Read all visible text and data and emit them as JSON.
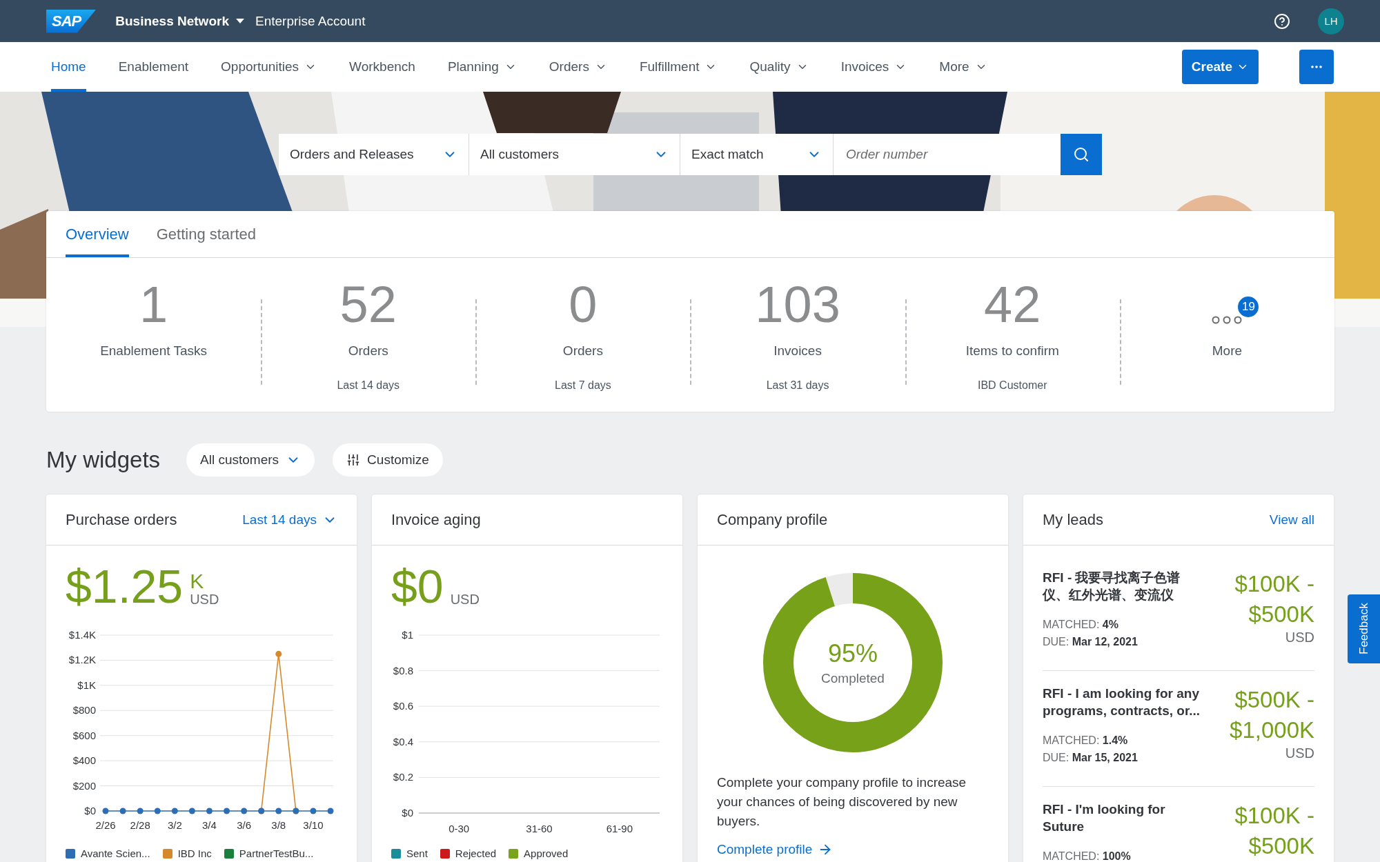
{
  "topbar": {
    "logo": "SAP",
    "product": "Business Network",
    "account": "Enterprise Account",
    "avatar": "LH"
  },
  "nav": {
    "items": [
      {
        "label": "Home",
        "selected": true,
        "has_menu": false
      },
      {
        "label": "Enablement",
        "selected": false,
        "has_menu": false
      },
      {
        "label": "Opportunities",
        "selected": false,
        "has_menu": true
      },
      {
        "label": "Workbench",
        "selected": false,
        "has_menu": false
      },
      {
        "label": "Planning",
        "selected": false,
        "has_menu": true
      },
      {
        "label": "Orders",
        "selected": false,
        "has_menu": true
      },
      {
        "label": "Fulfillment",
        "selected": false,
        "has_menu": true
      },
      {
        "label": "Quality",
        "selected": false,
        "has_menu": true
      },
      {
        "label": "Invoices",
        "selected": false,
        "has_menu": true
      },
      {
        "label": "More",
        "selected": false,
        "has_menu": true
      }
    ],
    "create_button": "Create"
  },
  "search": {
    "scope": "Orders and Releases",
    "customer": "All customers",
    "match": "Exact match",
    "placeholder": "Order number"
  },
  "overview": {
    "tabs": [
      {
        "label": "Overview",
        "selected": true
      },
      {
        "label": "Getting started",
        "selected": false
      }
    ],
    "tiles": [
      {
        "kind": "count",
        "value": "1",
        "label": "Enablement Tasks"
      },
      {
        "kind": "count",
        "value": "52",
        "label": "Orders",
        "period": "Last 14 days"
      },
      {
        "kind": "count",
        "value": "0",
        "label": "Orders",
        "period": "Last 7 days"
      },
      {
        "kind": "count",
        "value": "103",
        "label": "Invoices",
        "period": "Last 31 days"
      },
      {
        "kind": "count",
        "value": "42",
        "label": "Items to confirm",
        "period": "IBD Customer"
      },
      {
        "kind": "more",
        "label": "More",
        "badge": "19"
      }
    ]
  },
  "widgets": {
    "title": "My widgets",
    "customer_filter": "All customers",
    "customize_button": "Customize",
    "purchase_orders": {
      "title": "Purchase orders",
      "period": "Last 14 days",
      "amount": "$1.25",
      "unit": "K",
      "currency": "USD",
      "chart_data": {
        "type": "line",
        "grid": true,
        "categories": [
          "2/26",
          null,
          "2/28",
          null,
          "3/2",
          null,
          "3/4",
          null,
          "3/6",
          null,
          "3/8",
          null,
          "3/10",
          null
        ],
        "ylim": [
          0,
          1400
        ],
        "yticks": [
          {
            "value": 0,
            "label": "$0"
          },
          {
            "value": 200,
            "label": "$200"
          },
          {
            "value": 400,
            "label": "$400"
          },
          {
            "value": 600,
            "label": "$600"
          },
          {
            "value": 800,
            "label": "$800"
          },
          {
            "value": 1000,
            "label": "$1K"
          },
          {
            "value": 1200,
            "label": "$1.2K"
          },
          {
            "value": 1400,
            "label": "$1.4K"
          }
        ],
        "series": [
          {
            "name": "Avante Scien...",
            "color": "#2d6db5",
            "marker": true,
            "values": [
              0,
              0,
              0,
              0,
              0,
              0,
              0,
              0,
              0,
              0,
              0,
              0,
              0,
              0
            ]
          },
          {
            "name": "IBD Inc",
            "color": "#d5892c",
            "marker": true,
            "values": [
              null,
              null,
              null,
              null,
              null,
              null,
              null,
              null,
              null,
              0,
              1250,
              0,
              null,
              null
            ]
          },
          {
            "name": "PartnerTestBu...",
            "color": "#1b7f3e",
            "values": [
              null,
              null,
              null,
              null,
              null,
              null,
              null,
              null,
              null,
              null,
              null,
              null,
              null,
              null
            ]
          }
        ]
      }
    },
    "invoice_aging": {
      "title": "Invoice aging",
      "amount": "$0",
      "currency": "USD",
      "chart_data": {
        "type": "bar",
        "grid": true,
        "categories": [
          "0-30",
          "31-60",
          "61-90"
        ],
        "ylim": [
          0,
          1
        ],
        "yticks": [
          {
            "value": 0,
            "label": "$0"
          },
          {
            "value": 0.2,
            "label": "$0.2"
          },
          {
            "value": 0.4,
            "label": "$0.4"
          },
          {
            "value": 0.6,
            "label": "$0.6"
          },
          {
            "value": 0.8,
            "label": "$0.8"
          },
          {
            "value": 1,
            "label": "$1"
          }
        ],
        "series": [
          {
            "name": "Sent",
            "color": "#1a8d9a",
            "values": [
              0,
              0,
              0
            ]
          },
          {
            "name": "Rejected",
            "color": "#cc1919",
            "values": [
              0,
              0,
              0
            ]
          },
          {
            "name": "Approved",
            "color": "#78a31b",
            "values": [
              0,
              0,
              0
            ]
          }
        ]
      }
    },
    "company_profile": {
      "title": "Company profile",
      "percent": "95%",
      "status": "Completed",
      "level": 0.95,
      "text": "Complete your company profile to increase your chances of being discovered by new buyers.",
      "link": "Complete profile"
    },
    "leads": {
      "title": "My leads",
      "view_all": "View all",
      "items": [
        {
          "title": "RFI - 我要寻找离子色谱仪、红外光谱、变流仪",
          "matched": "MATCHED: **4%**",
          "due": "DUE: **Mar 12, 2021**",
          "range": "$100K - $500K",
          "currency": "USD"
        },
        {
          "title": "RFI - I am looking for any programs, contracts, or...",
          "matched": "MATCHED: **1.4%**",
          "due": "DUE: **Mar 15, 2021**",
          "range": "$500K - $1,000K",
          "currency": "USD"
        },
        {
          "title": "RFI - I'm looking for Suture",
          "matched": "MATCHED: **100%**",
          "range": "$100K - $500K"
        }
      ]
    }
  },
  "feedback_tab": "Feedback"
}
